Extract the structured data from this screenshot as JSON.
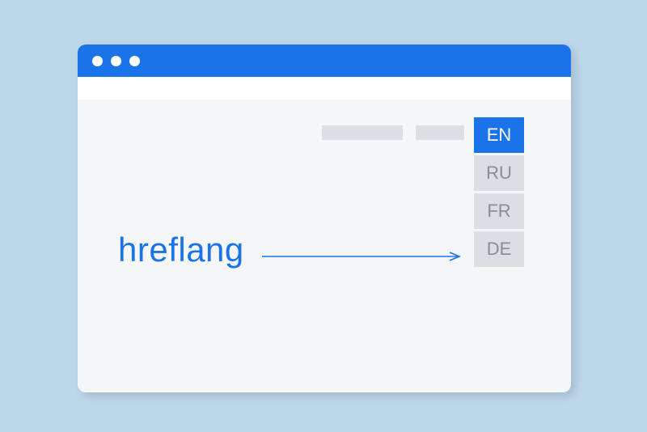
{
  "colors": {
    "background": "#bcd6ea",
    "primary": "#1a73e8",
    "window_bg": "#f5f6f8",
    "placeholder": "#dcdee3",
    "muted_text": "#8a8d93"
  },
  "label": "hreflang",
  "lang_menu": {
    "items": [
      {
        "code": "EN",
        "active": true
      },
      {
        "code": "RU",
        "active": false
      },
      {
        "code": "FR",
        "active": false
      },
      {
        "code": "DE",
        "active": false
      }
    ]
  }
}
